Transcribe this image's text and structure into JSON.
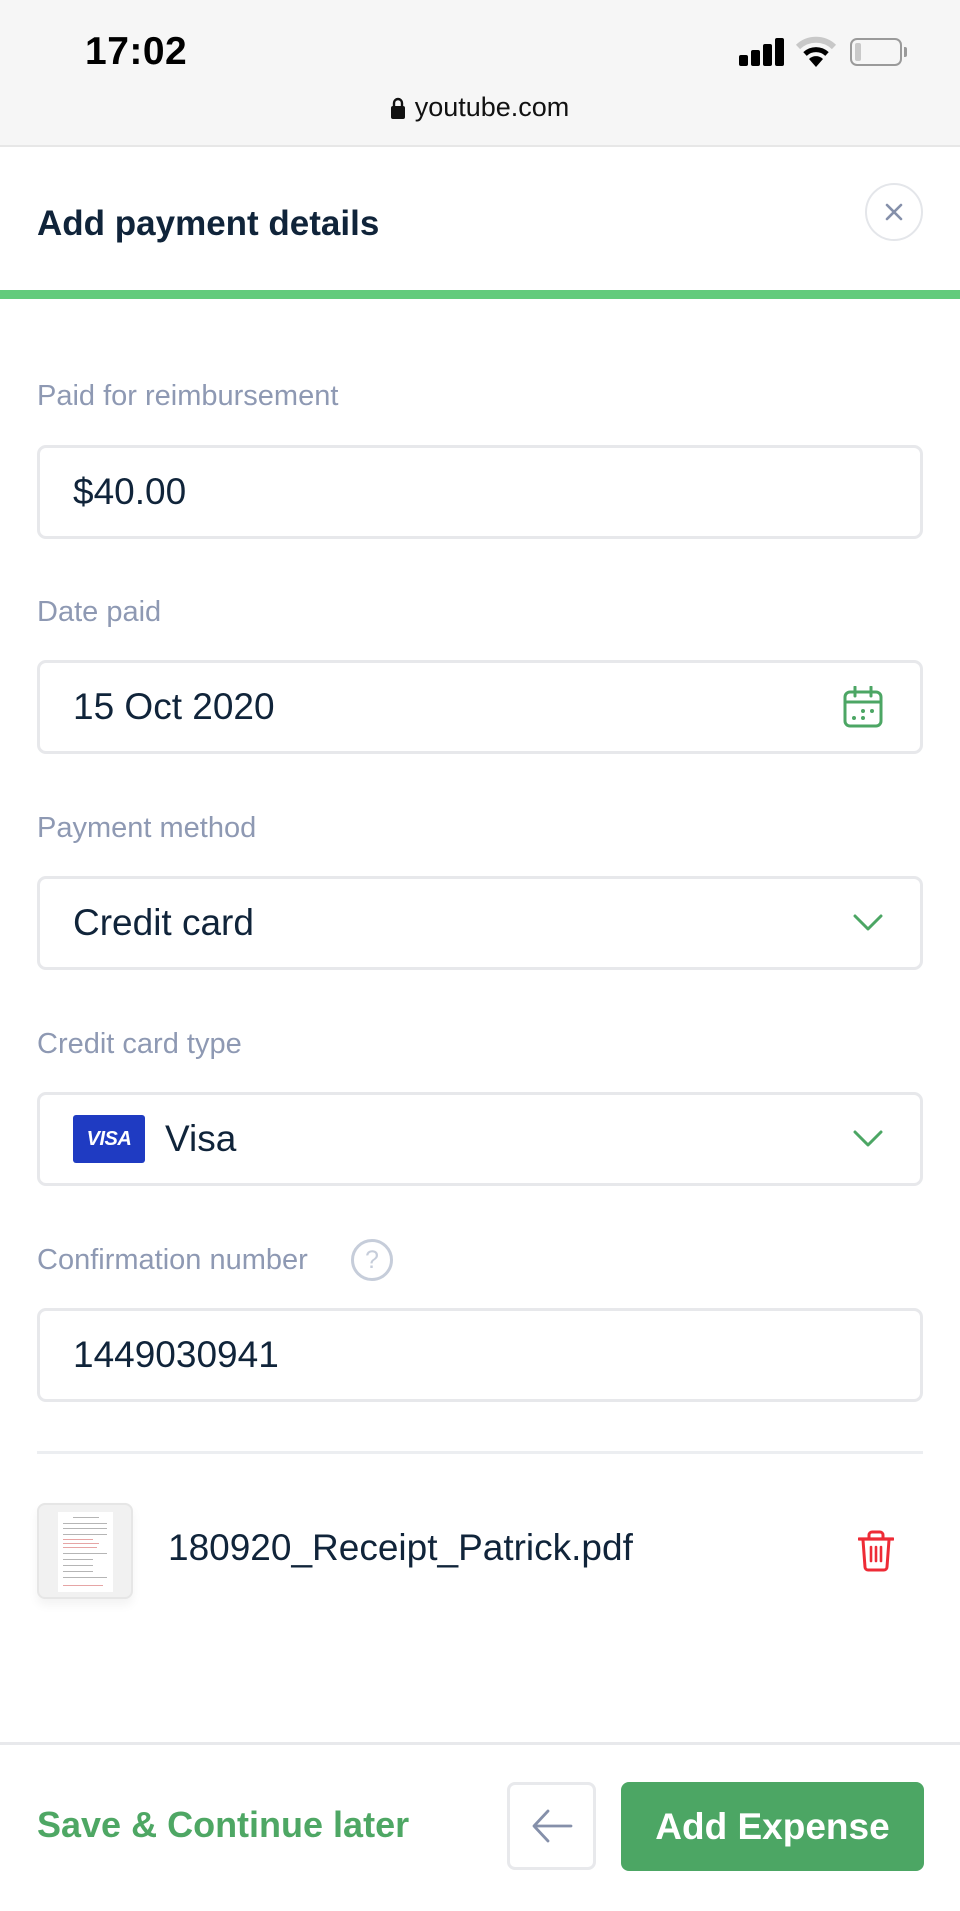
{
  "status_bar": {
    "time": "17:02",
    "url": "youtube.com",
    "icons": [
      "signal-icon",
      "wifi-icon",
      "battery-icon",
      "lock-icon"
    ]
  },
  "header": {
    "title": "Add payment details",
    "close_icon": "close-icon",
    "progress_fraction": 1.0,
    "progress_color": "#63cb7c"
  },
  "form": {
    "fields": [
      {
        "label": "Paid for reimbursement",
        "value": "$40.00",
        "type": "text"
      },
      {
        "label": "Date paid",
        "value": "15 Oct 2020",
        "type": "date",
        "icon": "calendar-icon"
      },
      {
        "label": "Payment method",
        "value": "Credit card",
        "type": "select",
        "icon": "chevron-down-icon"
      },
      {
        "label": "Credit card type",
        "value": "Visa",
        "type": "select",
        "badge": "VISA",
        "icon": "chevron-down-icon"
      },
      {
        "label": "Confirmation number",
        "value": "1449030941",
        "type": "text",
        "help_icon": "help-icon",
        "help_glyph": "?"
      }
    ]
  },
  "attachment": {
    "file_name": "180920_Receipt_Patrick.pdf",
    "thumbnail_icon": "document-thumbnail",
    "delete_icon": "trash-icon"
  },
  "footer": {
    "save_later_label": "Save & Continue later",
    "back_icon": "arrow-left-icon",
    "primary_label": "Add Expense"
  },
  "colors": {
    "accent_green": "#4ca664",
    "label_gray": "#8e99b3",
    "text_dark": "#10243a",
    "danger_red": "#ee2b36",
    "visa_blue": "#1f3bc2"
  }
}
